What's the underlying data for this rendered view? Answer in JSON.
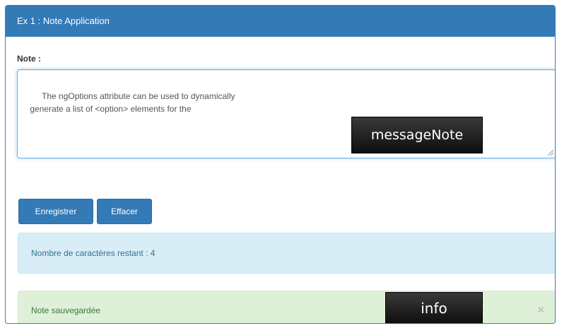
{
  "panel": {
    "title": "Ex 1 : Note Application"
  },
  "form": {
    "note_label": "Note :",
    "note_value": "The ngOptions attribute can be used to dynamically\n generate a list of <option> elements for the"
  },
  "annotations": {
    "message_tag": "messageNote",
    "info_tag": "info"
  },
  "buttons": {
    "save_label": "Enregistrer",
    "clear_label": "Effacer"
  },
  "alerts": {
    "remaining_text": "Nombre de caractères restant : 4",
    "saved_text": "Note sauvegardée",
    "close_symbol": "×"
  },
  "colors": {
    "primary": "#337ab7",
    "info_bg": "#d9edf7",
    "success_bg": "#dff0d8"
  }
}
